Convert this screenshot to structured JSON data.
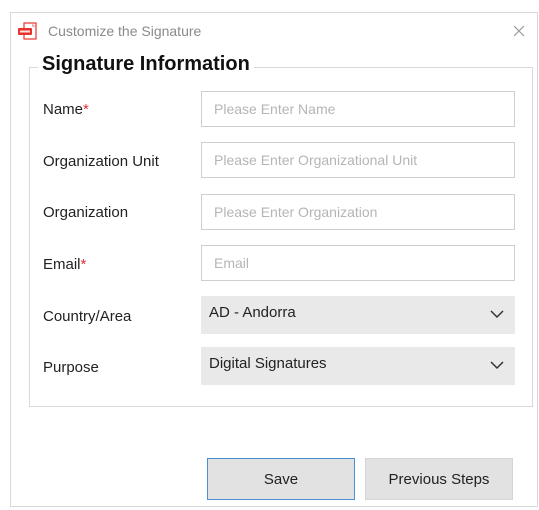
{
  "window": {
    "title": "Customize the Signature",
    "app_icon": "pdf-app-icon",
    "close_icon": "close-icon"
  },
  "form": {
    "section_title": "Signature Information",
    "required_marker": "*",
    "fields": {
      "name": {
        "label": "Name",
        "placeholder": "Please Enter Name",
        "value": ""
      },
      "org_unit": {
        "label": "Organization Unit",
        "placeholder": "Please Enter Organizational Unit",
        "value": ""
      },
      "organization": {
        "label": "Organization",
        "placeholder": "Please Enter Organization",
        "value": ""
      },
      "email": {
        "label": "Email",
        "placeholder": "Email",
        "value": ""
      },
      "country": {
        "label": "Country/Area",
        "selected": "AD - Andorra"
      },
      "purpose": {
        "label": "Purpose",
        "selected": "Digital Signatures"
      }
    }
  },
  "buttons": {
    "save": "Save",
    "previous": "Previous Steps"
  },
  "colors": {
    "required": "#e03030",
    "focus_border": "#4a90d9",
    "select_bg": "#e9e9e9",
    "app_icon_red": "#e8322e"
  }
}
